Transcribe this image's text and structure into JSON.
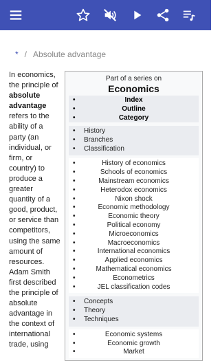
{
  "toolbar": {
    "icons": [
      "menu-icon",
      "star-icon",
      "volume-off-icon",
      "play-icon",
      "share-icon",
      "playlist-icon"
    ],
    "bg_color": "#3f51b5"
  },
  "breadcrumb": {
    "home": "*",
    "separator": "/",
    "current": "Absolute advantage"
  },
  "article": {
    "lines": [
      {
        "text": "In economics,"
      },
      {
        "text": "the principle of"
      },
      {
        "text": "absolute",
        "bold": true
      },
      {
        "text": "advantage",
        "bold": true
      },
      {
        "text": "refers to the"
      },
      {
        "text": "ability of a"
      },
      {
        "text": "party (an"
      },
      {
        "text": "individual, or"
      },
      {
        "text": "firm, or"
      },
      {
        "text": "country) to"
      },
      {
        "text": "produce a"
      },
      {
        "text": "greater"
      },
      {
        "text": "quantity of a"
      },
      {
        "text": "good, product,"
      },
      {
        "text": "or service than"
      },
      {
        "text": "competitors,"
      },
      {
        "text": "using the same"
      },
      {
        "text": "amount of"
      },
      {
        "text": "resources."
      },
      {
        "text": "Adam Smith"
      },
      {
        "text": "first described"
      },
      {
        "text": "the principle of"
      },
      {
        "text": "absolute"
      },
      {
        "text": "advantage in"
      },
      {
        "text": "the context of"
      },
      {
        "text": "international"
      },
      {
        "text": "trade, using"
      }
    ]
  },
  "infobox": {
    "part_of": "Part of a series on",
    "title": "Economics",
    "nav": [
      "Index",
      "Outline",
      "Category"
    ],
    "group1": [
      "History",
      "Branches",
      "Classification"
    ],
    "list1": [
      "History of economics",
      "Schools of economics",
      "Mainstream economics",
      "Heterodox economics",
      "Nixon shock",
      "Economic methodology",
      "Economic theory",
      "Political economy",
      "Microeconomics",
      "Macroeconomics",
      "International economics",
      "Applied economics",
      "Mathematical economics",
      "Econometrics",
      "JEL classification codes"
    ],
    "group2": [
      "Concepts",
      "Theory",
      "Techniques"
    ],
    "list2": [
      "Economic systems",
      "Economic growth",
      "Market"
    ]
  }
}
